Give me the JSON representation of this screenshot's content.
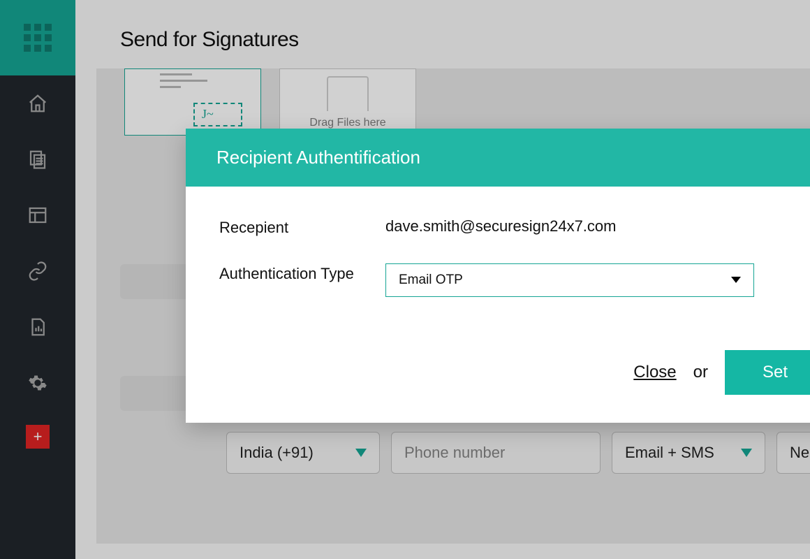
{
  "page": {
    "title": "Send for Signatures"
  },
  "sidebar": {
    "icons": [
      "apps-grid-icon",
      "home-icon",
      "documents-icon",
      "table-icon",
      "link-icon",
      "report-icon",
      "gear-icon",
      "add-icon"
    ]
  },
  "dropzone": {
    "label": "Drag Files here"
  },
  "form": {
    "country_code": "India (+91)",
    "phone_placeholder": "Phone number",
    "delivery": "Email + SMS",
    "role": "Nee"
  },
  "modal": {
    "title": "Recipient Authentification",
    "recipient_label": "Recepient",
    "recipient_value": "dave.smith@securesign24x7.com",
    "auth_label": "Authentication Type",
    "auth_value": "Email OTP",
    "close_label": "Close",
    "or_label": "or",
    "set_label": "Set"
  }
}
